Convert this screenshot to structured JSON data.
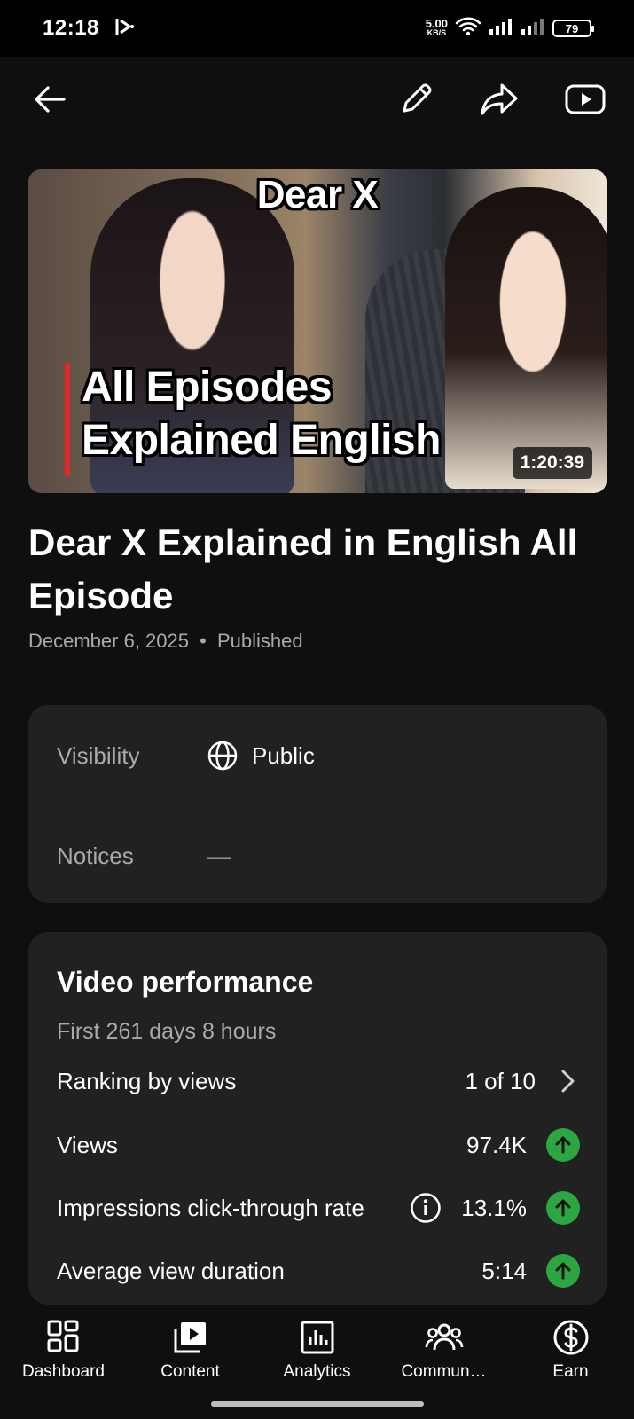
{
  "status_bar": {
    "time": "12:18",
    "net_speed_value": "5.00",
    "net_speed_unit": "KB/S",
    "battery": "79"
  },
  "app_bar": {
    "back_icon": "arrow-left-icon",
    "edit_icon": "pencil-icon",
    "share_icon": "share-icon",
    "youtube_icon": "play-box-icon"
  },
  "thumbnail": {
    "top_text": "Dear X",
    "line1": "All Episodes",
    "line2": "Explained English",
    "duration": "1:20:39"
  },
  "video": {
    "title": "Dear X Explained in English All Episode",
    "date": "December 6, 2025",
    "separator": "•",
    "status": "Published"
  },
  "details": {
    "visibility_label": "Visibility",
    "visibility_value": "Public",
    "notices_label": "Notices",
    "notices_value": "—"
  },
  "performance": {
    "heading": "Video performance",
    "period": "First 261 days 8 hours",
    "rows": [
      {
        "name": "Ranking by views",
        "value": "1 of 10",
        "indicator": "chevron-right"
      },
      {
        "name": "Views",
        "value": "97.4K",
        "indicator": "up"
      },
      {
        "name": "Impressions click-through rate",
        "value": "13.1%",
        "indicator": "up",
        "info": true
      },
      {
        "name": "Average view duration",
        "value": "5:14",
        "indicator": "up"
      }
    ]
  },
  "bottom_nav": {
    "items": [
      {
        "label": "Dashboard",
        "icon": "dashboard-icon"
      },
      {
        "label": "Content",
        "icon": "content-icon"
      },
      {
        "label": "Analytics",
        "icon": "analytics-icon"
      },
      {
        "label": "Commun…",
        "icon": "community-icon"
      },
      {
        "label": "Earn",
        "icon": "earn-icon"
      }
    ]
  },
  "colors": {
    "background": "#0f0f0f",
    "card": "#212121",
    "secondary_text": "#aaaaaa",
    "trend_up": "#2ba640",
    "accent_red": "#e02828"
  }
}
